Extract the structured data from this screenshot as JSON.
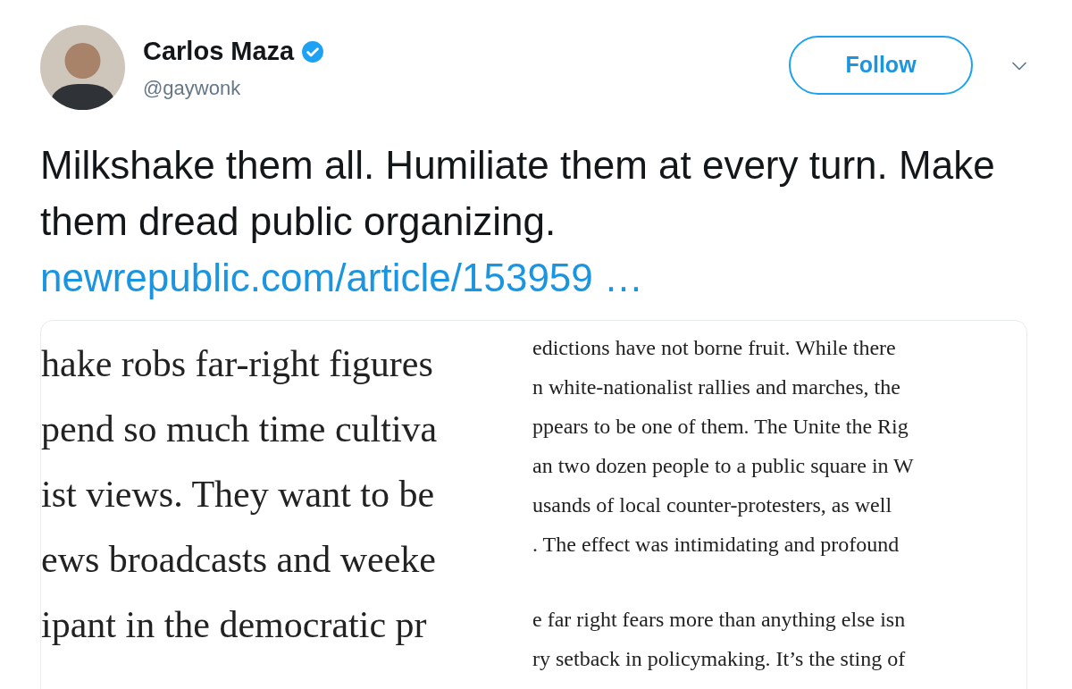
{
  "author": {
    "name": "Carlos Maza",
    "handle": "@gaywonk",
    "verified": true
  },
  "follow_button": {
    "label": "Follow"
  },
  "tweet_text": "Milkshake them all. Humiliate them at every turn. Make them dread public organizing.",
  "link": "newrepublic.com/article/153959 …",
  "media": {
    "left_lines": [
      "hake robs far-right figures",
      "pend so much time cultiva",
      "ist views. They want to be",
      "ews broadcasts and weeke",
      "ipant in the democratic pr"
    ],
    "right_paragraphs": [
      [
        "edictions have not borne fruit. While there",
        "n white-nationalist rallies and marches, the",
        "ppears to be one of them. The Unite the Rig",
        "an two dozen people to a public square in W",
        "usands of local counter-protesters, as well",
        ". The effect was intimidating and profound"
      ],
      [
        "e far right fears more than anything else isn",
        "ry setback in policymaking. It’s the sting of"
      ]
    ]
  }
}
